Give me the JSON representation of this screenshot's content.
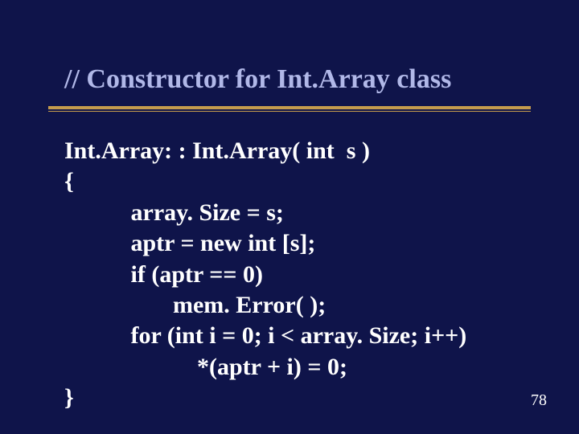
{
  "title": "// Constructor for Int.Array class",
  "code": {
    "line1": "Int.Array: : Int.Array( int  s )",
    "line2": "{",
    "line3": "           array. Size = s;",
    "line4": "           aptr = new int [s];",
    "line5": "           if (aptr == 0)",
    "line6": "                  mem. Error( );",
    "line7": "           for (int i = 0; i < array. Size; i++)",
    "line8": "                      *(aptr + i) = 0;",
    "line9": "}"
  },
  "page_number": "78"
}
